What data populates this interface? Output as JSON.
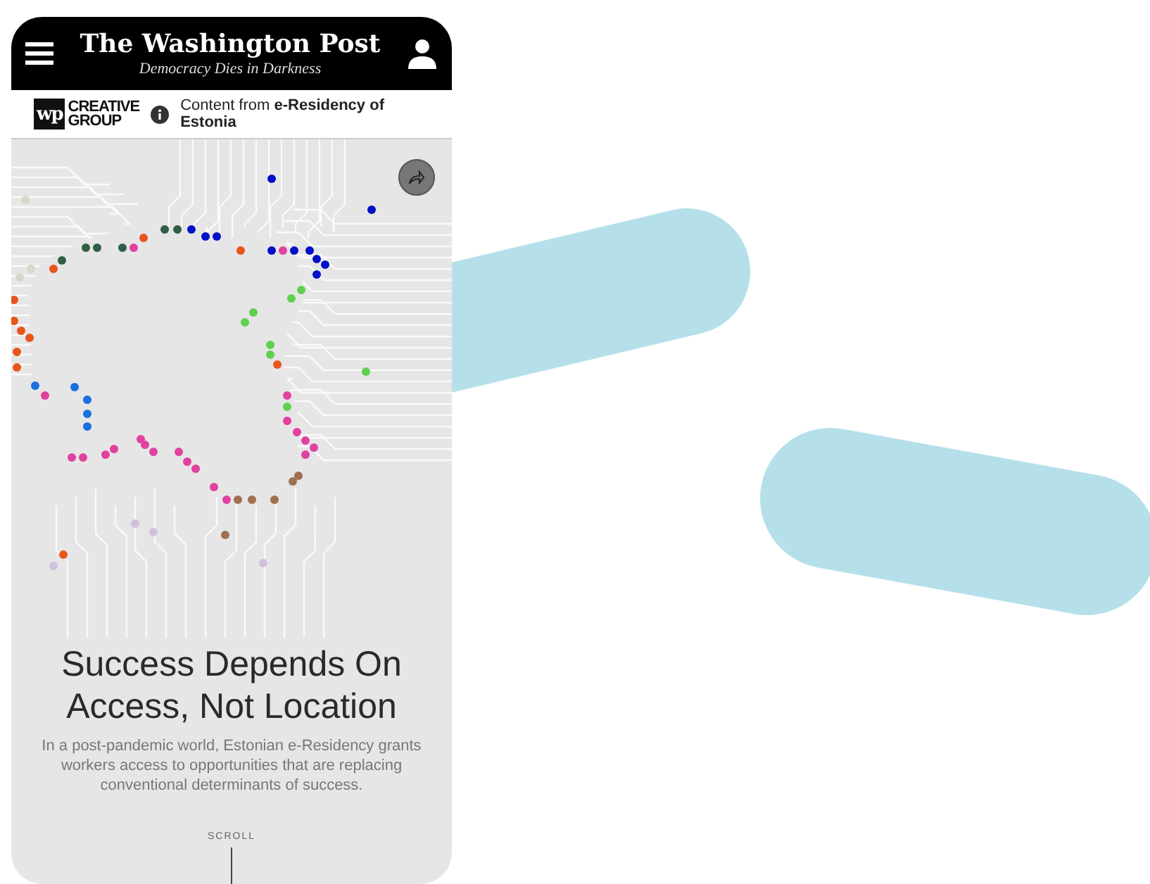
{
  "header": {
    "title": "The Washington Post",
    "tagline": "Democracy Dies in Darkness"
  },
  "sponsor_bar": {
    "logo_mark": "wp",
    "logo_lines": [
      "CREATIVE",
      "GROUP"
    ],
    "text": "Content from **e-Residency of Estonia**"
  },
  "article": {
    "headline": "Success Depends On Access, Not Location",
    "deck": "In a post-pandemic world, Estonian e-Residency grants workers access to opportunities that are replacing conventional determinants of success.",
    "scroll_label": "SCROLL"
  }
}
